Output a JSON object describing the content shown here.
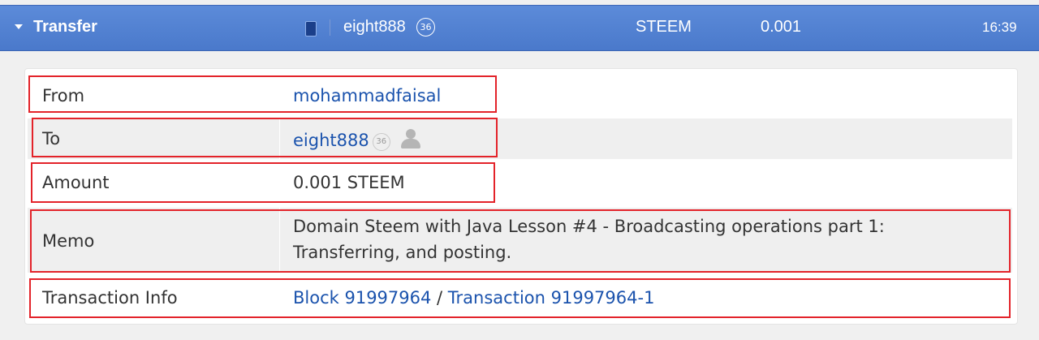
{
  "header": {
    "title": "Transfer",
    "user": "eight888",
    "reputation": "36",
    "currency": "STEEM",
    "amount": "0.001",
    "time": "16:39"
  },
  "details": {
    "from_label": "From",
    "from_value": "mohammadfaisal",
    "to_label": "To",
    "to_value": "eight888",
    "to_reputation": "36",
    "amount_label": "Amount",
    "amount_value": "0.001 STEEM",
    "memo_label": "Memo",
    "memo_line1": "Domain Steem with Java Lesson #4 - Broadcasting operations part 1:",
    "memo_line2": "Transferring, and posting.",
    "tx_label": "Transaction Info",
    "block_link": "Block 91997964",
    "separator": " / ",
    "tx_link": "Transaction 91997964-1"
  },
  "colors": {
    "header_bg": "#4f7fd0",
    "link": "#1b53ad",
    "highlight": "#e3232a"
  },
  "icons": [
    "caret-down-icon",
    "wallet-square-icon",
    "user-avatar-icon"
  ]
}
